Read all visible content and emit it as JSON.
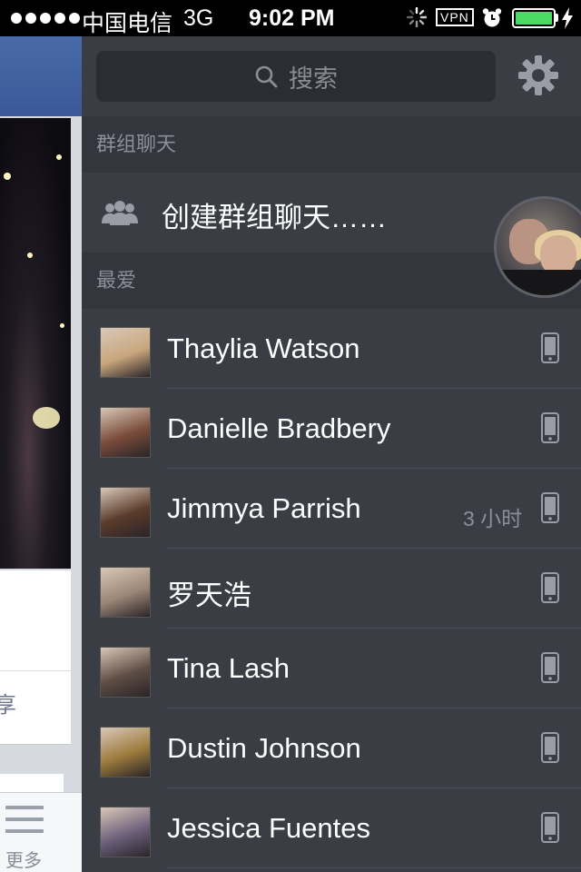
{
  "status_bar": {
    "carrier": "中国电信",
    "network": "3G",
    "time": "9:02 PM",
    "vpn": "VPN",
    "battery_color": "#4cd964"
  },
  "feed": {
    "share_fragment": "享",
    "more_label": "更多"
  },
  "sidebar": {
    "search_placeholder": "搜索",
    "group_section_title": "群组聊天",
    "create_group_label": "创建群组聊天……",
    "favorites_section_title": "最爱",
    "contacts": [
      {
        "name": "Thaylia Watson",
        "status": "",
        "avatar_color": "#c9a77d"
      },
      {
        "name": "Danielle Bradbery",
        "status": "",
        "avatar_color": "#7a4b3a"
      },
      {
        "name": "Jimmya Parrish",
        "status": "3 小时",
        "avatar_color": "#5a3b2b"
      },
      {
        "name": "罗天浩",
        "status": "",
        "avatar_color": "#9a8576"
      },
      {
        "name": "Tina Lash",
        "status": "",
        "avatar_color": "#5e4d44"
      },
      {
        "name": "Dustin Johnson",
        "status": "",
        "avatar_color": "#9c7a3c"
      },
      {
        "name": "Jessica Fuentes",
        "status": "",
        "avatar_color": "#6c5f7a"
      }
    ]
  }
}
